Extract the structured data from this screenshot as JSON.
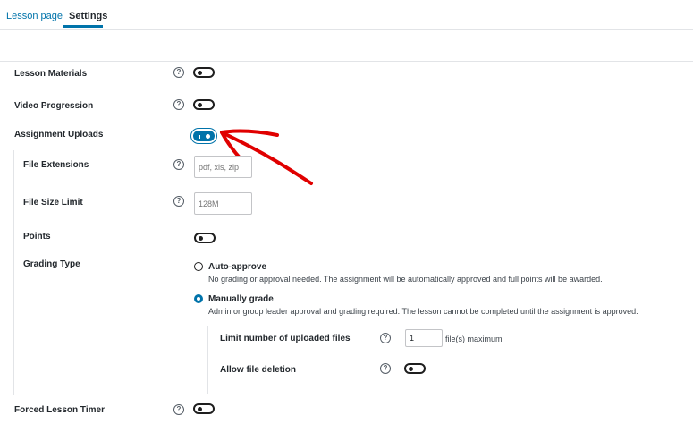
{
  "tabs": {
    "lesson": "Lesson page",
    "settings": "Settings"
  },
  "help_glyph": "?",
  "settings": {
    "lesson_materials": {
      "label": "Lesson Materials"
    },
    "video_progression": {
      "label": "Video Progression"
    },
    "assignment_uploads": {
      "label": "Assignment Uploads"
    },
    "file_extensions": {
      "label": "File Extensions",
      "placeholder": "pdf, xls, zip"
    },
    "file_size_limit": {
      "label": "File Size Limit",
      "placeholder": "128M"
    },
    "points": {
      "label": "Points"
    },
    "grading_type": {
      "label": "Grading Type",
      "auto": {
        "title": "Auto-approve",
        "desc": "No grading or approval needed. The assignment will be automatically approved and full points will be awarded."
      },
      "manual": {
        "title": "Manually grade",
        "desc": "Admin or group leader approval and grading required. The lesson cannot be completed until the assignment is approved."
      }
    },
    "limit_uploads": {
      "label": "Limit number of uploaded files",
      "value": "1",
      "suffix": "file(s) maximum"
    },
    "allow_deletion": {
      "label": "Allow file deletion"
    },
    "forced_timer": {
      "label": "Forced Lesson Timer"
    }
  },
  "colors": {
    "accent": "#0073aa",
    "annotation_arrow": "#e00000"
  }
}
